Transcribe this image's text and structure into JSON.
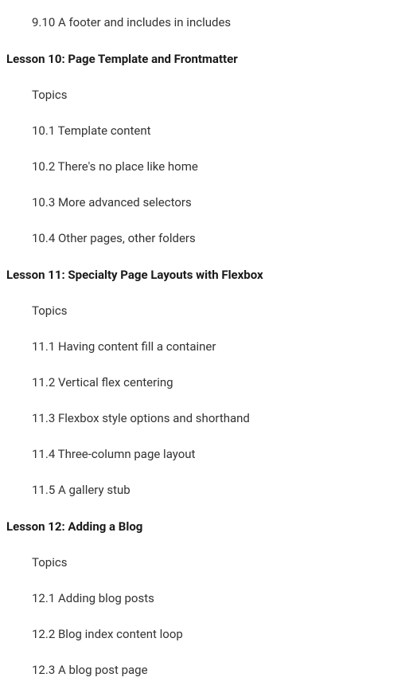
{
  "outline": [
    {
      "kind": "topic",
      "text": "9.10 A footer and includes in includes"
    },
    {
      "kind": "lesson",
      "text": "Lesson 10: Page Template and Frontmatter"
    },
    {
      "kind": "topic",
      "text": "Topics"
    },
    {
      "kind": "topic",
      "text": "10.1 Template content"
    },
    {
      "kind": "topic",
      "text": "10.2 There's no place like home"
    },
    {
      "kind": "topic",
      "text": "10.3 More advanced selectors"
    },
    {
      "kind": "topic",
      "text": "10.4 Other pages, other folders"
    },
    {
      "kind": "lesson",
      "text": "Lesson 11: Specialty Page Layouts with Flexbox"
    },
    {
      "kind": "topic",
      "text": "Topics"
    },
    {
      "kind": "topic",
      "text": "11.1 Having content fill a container"
    },
    {
      "kind": "topic",
      "text": "11.2 Vertical flex centering"
    },
    {
      "kind": "topic",
      "text": "11.3 Flexbox style options and shorthand"
    },
    {
      "kind": "topic",
      "text": "11.4 Three-column page layout"
    },
    {
      "kind": "topic",
      "text": "11.5 A gallery stub"
    },
    {
      "kind": "lesson",
      "text": "Lesson 12: Adding a Blog"
    },
    {
      "kind": "topic",
      "text": "Topics"
    },
    {
      "kind": "topic",
      "text": "12.1 Adding blog posts"
    },
    {
      "kind": "topic",
      "text": "12.2 Blog index content loop"
    },
    {
      "kind": "topic",
      "text": "12.3 A blog post page"
    }
  ]
}
